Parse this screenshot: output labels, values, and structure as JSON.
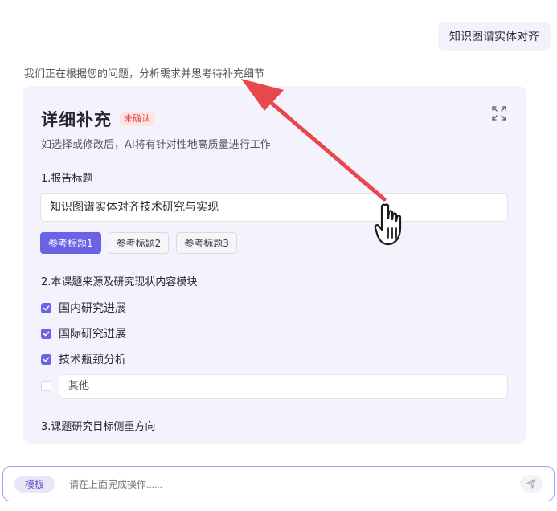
{
  "user_message": "知识图谱实体对齐",
  "status_text": "我们正在根据您的问题，分析需求并思考待补充细节",
  "panel": {
    "title": "详细补充",
    "badge": "未确认",
    "subtitle": "如选择或修改后，AI将有针对性地高质量进行工作",
    "expand_icon": "expand-icon",
    "sections": [
      {
        "label": "1.报告标题",
        "value": "知识图谱实体对齐技术研究与实现",
        "references": [
          {
            "label": "参考标题1",
            "active": true
          },
          {
            "label": "参考标题2",
            "active": false
          },
          {
            "label": "参考标题3",
            "active": false
          }
        ]
      },
      {
        "label": "2.本课题来源及研究现状内容模块",
        "options": [
          {
            "label": "国内研究进展",
            "checked": true
          },
          {
            "label": "国际研究进展",
            "checked": true
          },
          {
            "label": "技术瓶颈分析",
            "checked": true
          },
          {
            "label": "其他",
            "checked": false
          }
        ]
      },
      {
        "label": "3.课题研究目标侧重方向"
      }
    ]
  },
  "composer": {
    "template_label": "模板",
    "placeholder": "请在上面完成操作......",
    "send_icon": "send-icon"
  },
  "overlay": {
    "arrow_color": "#e8474b",
    "cursor_icon": "hand-pointer-icon"
  },
  "colors": {
    "accent": "#6b63e6",
    "panel_bg": "#f4f2fc",
    "badge_red": "#e2443c"
  }
}
